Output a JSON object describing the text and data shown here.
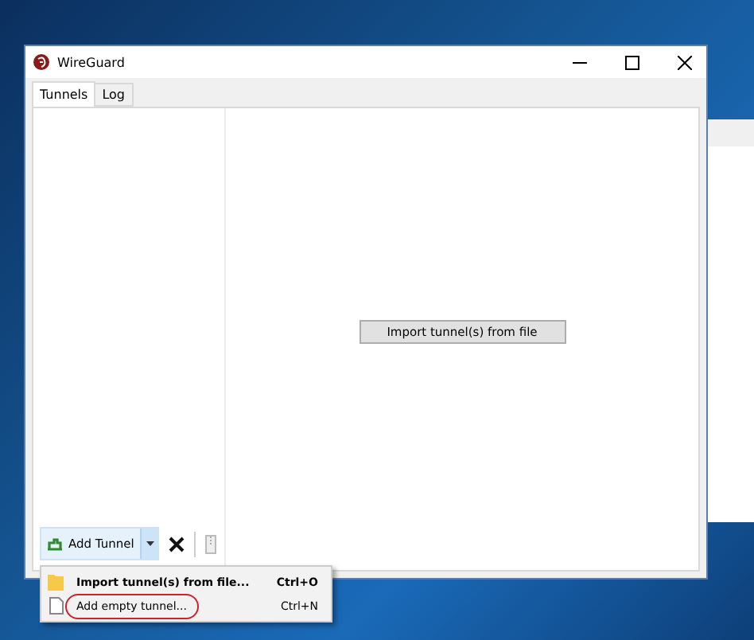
{
  "window": {
    "title": "WireGuard"
  },
  "tabs": [
    {
      "label": "Tunnels",
      "selected": true
    },
    {
      "label": "Log",
      "selected": false
    }
  ],
  "import_button": "Import tunnel(s) from file",
  "toolbar": {
    "add_button": "Add Tunnel"
  },
  "menu": {
    "items": [
      {
        "label": "Import tunnel(s) from file...",
        "shortcut": "Ctrl+O",
        "kind": "folder",
        "default": true,
        "circled": false
      },
      {
        "label": "Add empty tunnel...",
        "shortcut": "Ctrl+N",
        "kind": "file",
        "default": false,
        "circled": true
      }
    ]
  }
}
